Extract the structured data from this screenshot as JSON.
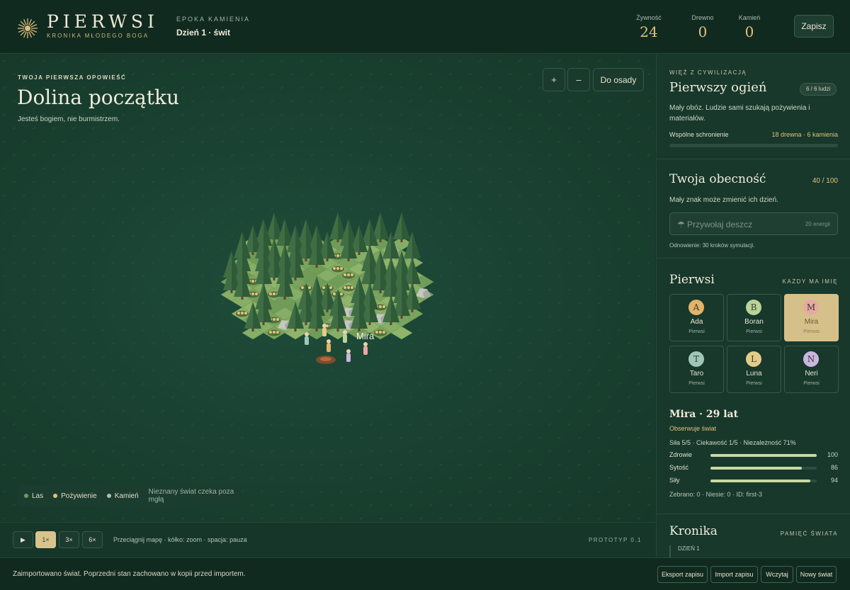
{
  "header": {
    "brand": "PIERWSI",
    "brand_sub": "KRONIKA MŁODEGO BOGA",
    "era": "EPOKA KAMIENIA",
    "day": "Dzień 1 · świt",
    "resources": [
      {
        "label": "Żywność",
        "value": "24"
      },
      {
        "label": "Drewno",
        "value": "0"
      },
      {
        "label": "Kamień",
        "value": "0"
      }
    ],
    "save_label": "Zapisz"
  },
  "map": {
    "eyebrow": "TWOJA PIERWSZA OPOWIEŚĆ",
    "title": "Dolina początku",
    "tagline": "Jesteś bogiem, nie burmistrzem.",
    "zoom_in": "+",
    "zoom_out": "–",
    "goto_settlement": "Do osady",
    "unit_label": "Mira",
    "legend": {
      "forest": "Las",
      "food": "Pożywienie",
      "stone": "Kamień",
      "note": "Nieznany świat czeka poza mgłą"
    },
    "colors": {
      "forest": "#6f9a5e",
      "food": "#e3c17a",
      "stone": "#b8bfb4"
    }
  },
  "controls": {
    "play": "▶",
    "speeds": [
      "1×",
      "3×",
      "6×"
    ],
    "active_speed": "1×",
    "hint": "Przeciągnij mapę · kółko: zoom · spacja: pauza",
    "version": "PROTOTYP 0.1"
  },
  "status": {
    "message": "Zaimportowano świat. Poprzedni stan zachowano w kopii przed importem.",
    "export": "Eksport zapisu",
    "import": "Import zapisu",
    "load": "Wczytaj",
    "new_world": "Nowy świat"
  },
  "civ": {
    "eyebrow": "WIĘŹ Z CYWILIZACJĄ",
    "title": "Pierwszy ogień",
    "people_badge": "6 / 6 ludzi",
    "desc": "Mały obóz. Ludzie sami szukają pożywienia i materiałów.",
    "goal_label": "Wspólne schronienie",
    "goal_cost": "18 drewna · 6 kamienia",
    "goal_progress": 0
  },
  "presence": {
    "title": "Twoja obecność",
    "value": "40 / 100",
    "desc": "Mały znak może zmienić ich dzień.",
    "rain_label": "☂ Przywołaj deszcz",
    "rain_cost": "20 energii",
    "cooldown": "Odnowienie: 30 kroków symulacji."
  },
  "people": {
    "title": "Pierwsi",
    "eyebrow": "KAŻDY MA IMIĘ",
    "list": [
      {
        "initial": "A",
        "name": "Ada",
        "group": "Pierwsi",
        "color": "#e3b36a"
      },
      {
        "initial": "B",
        "name": "Boran",
        "group": "Pierwsi",
        "color": "#b9d39a"
      },
      {
        "initial": "M",
        "name": "Mira",
        "group": "Pierwsi",
        "color": "#e7a9a4"
      },
      {
        "initial": "T",
        "name": "Taro",
        "group": "Pierwsi",
        "color": "#9fc7b9"
      },
      {
        "initial": "L",
        "name": "Luna",
        "group": "Pierwsi",
        "color": "#e3cc8a"
      },
      {
        "initial": "N",
        "name": "Neri",
        "group": "Pierwsi",
        "color": "#c9b6e0"
      }
    ],
    "selected": "Mira"
  },
  "detail": {
    "name": "Mira · 29 lat",
    "action": "Obserwuje świat",
    "traits": "Siła 5/5 · Ciekawość 1/5 · Niezależność 71%",
    "stats": [
      {
        "label": "Zdrowie",
        "value": 100
      },
      {
        "label": "Sytość",
        "value": 86
      },
      {
        "label": "Siły",
        "value": 94
      }
    ],
    "footer": "Zebrano: 0 · Niesie: 0 · ID: first-3"
  },
  "chronicle": {
    "title": "Kronika",
    "eyebrow": "PAMIĘĆ ŚWIATA",
    "entry": "DZIEŃ 1"
  }
}
